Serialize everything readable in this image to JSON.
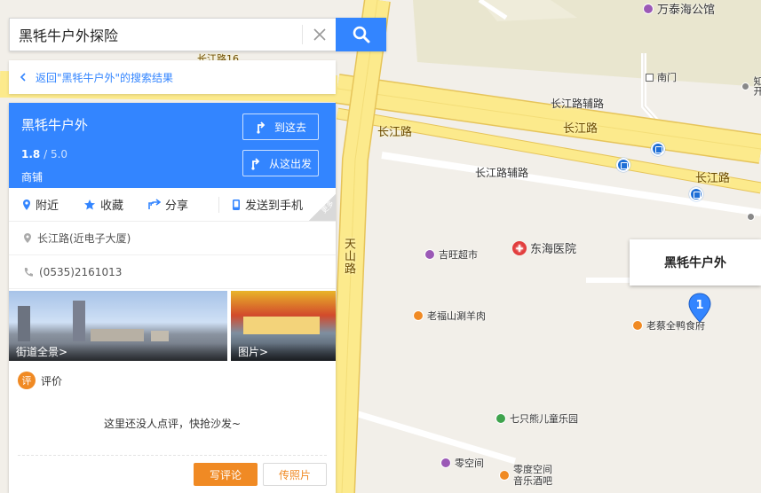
{
  "search": {
    "value": "黑牦牛户外探险"
  },
  "back": {
    "label": "返回\"黑牦牛户外\"的搜索结果"
  },
  "place": {
    "name": "黑牦牛户外",
    "rating": "1.8",
    "rating_max": "/ 5.0",
    "category": "商铺",
    "go_here": "到这去",
    "from_here": "从这出发"
  },
  "actions": {
    "nearby": "附近",
    "favorite": "收藏",
    "share": "分享",
    "send_phone": "发送到手机",
    "more": "更多"
  },
  "info": {
    "address": "长江路(近电子大厦)",
    "phone": "(0535)2161013"
  },
  "photos": {
    "street_view": "街道全景>",
    "pictures": "图片>"
  },
  "review": {
    "badge": "评",
    "title": "评价",
    "empty": "这里还没人点评，快抢沙发~",
    "write": "写评论",
    "upload_photo": "传照片"
  },
  "map": {
    "pois": {
      "wantai": "万泰海公馆",
      "south_gate": "南门",
      "jiwang": "吉旺超市",
      "donghai": "东海医院",
      "laofushan": "老福山涮羊肉",
      "laocai": "老蔡全鸭食府",
      "qizhixiong": "七只熊儿童乐园",
      "lingkongjian": "零空间",
      "lingdu_line1": "零度空间",
      "lingdu_line2": "音乐酒吧",
      "edge_top": "长江路16",
      "edge_right_1": "知",
      "edge_right_2": "开"
    },
    "roads": {
      "changjiang_1": "长江路",
      "changjiang_2": "长江路",
      "changjiang_3": "长江路",
      "changjiang_aux_1": "长江路辅路",
      "changjiang_aux_2": "长江路辅路",
      "tianshan": "天山路"
    },
    "marker": {
      "number": "1",
      "label": "黑牦牛户外"
    }
  },
  "colors": {
    "accent_blue": "#3385ff",
    "orange": "#f08a24",
    "road_yellow": "#fcea8c",
    "road_border": "#e6c45a",
    "map_bg": "#f2efe9"
  }
}
